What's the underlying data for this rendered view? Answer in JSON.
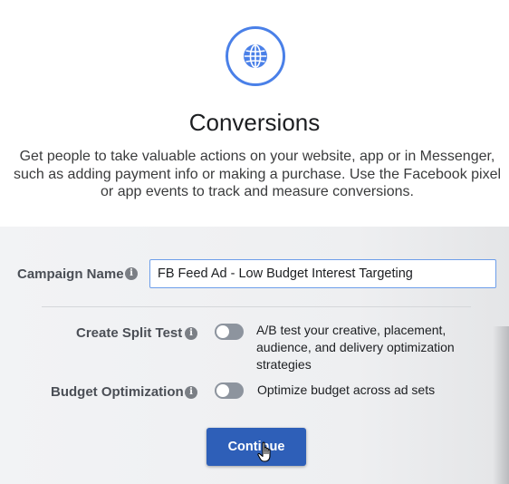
{
  "objective": {
    "icon": "globe-icon",
    "title": "Conversions",
    "description_lines": [
      "Get people to take valuable actions on your website, app or in Messenger,",
      "such as adding payment info or making a purchase. Use the Facebook pixel",
      "or app events to track and measure conversions."
    ]
  },
  "campaign_name": {
    "label": "Campaign Name",
    "value": "FB Feed Ad - Low Budget Interest Targeting"
  },
  "split_test": {
    "label": "Create Split Test",
    "enabled": false,
    "description_lines": [
      "A/B test your creative, placement,",
      "audience, and delivery optimization",
      "strategies"
    ]
  },
  "budget_optimization": {
    "label": "Budget Optimization",
    "enabled": false,
    "description": "Optimize budget across ad sets"
  },
  "continue_button": {
    "label": "Continue"
  },
  "colors": {
    "accent_blue": "#4a80e8",
    "button_blue": "#2e5fb8",
    "toggle_off": "#8d949e"
  }
}
